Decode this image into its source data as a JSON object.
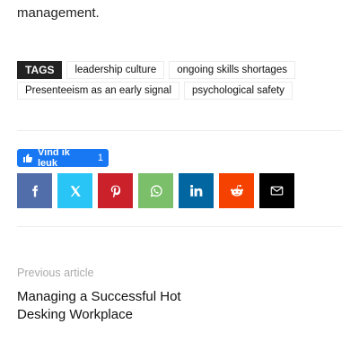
{
  "intro": {
    "text": "management."
  },
  "tags": {
    "label": "TAGS",
    "row1": [
      "leadership culture",
      "ongoing skills shortages"
    ],
    "row2": [
      "Presenteeism as an early signal",
      "psychological safety"
    ]
  },
  "like": {
    "label": "Vind ik leuk",
    "count": "1",
    "color": "#1877f2"
  },
  "share": {
    "buttons": [
      {
        "name": "facebook-icon",
        "color": "#516eab"
      },
      {
        "name": "x-twitter-icon",
        "color": "#29c5f6"
      },
      {
        "name": "pinterest-icon",
        "color": "#ca212a"
      },
      {
        "name": "whatsapp-icon",
        "color": "#7bbf6a"
      },
      {
        "name": "linkedin-icon",
        "color": "#0266a0"
      },
      {
        "name": "reddit-icon",
        "color": "#f54200"
      },
      {
        "name": "email-icon",
        "color": "#000000"
      }
    ]
  },
  "previous_article": {
    "label": "Previous article",
    "title": "Managing a Successful Hot Desking Workplace"
  }
}
